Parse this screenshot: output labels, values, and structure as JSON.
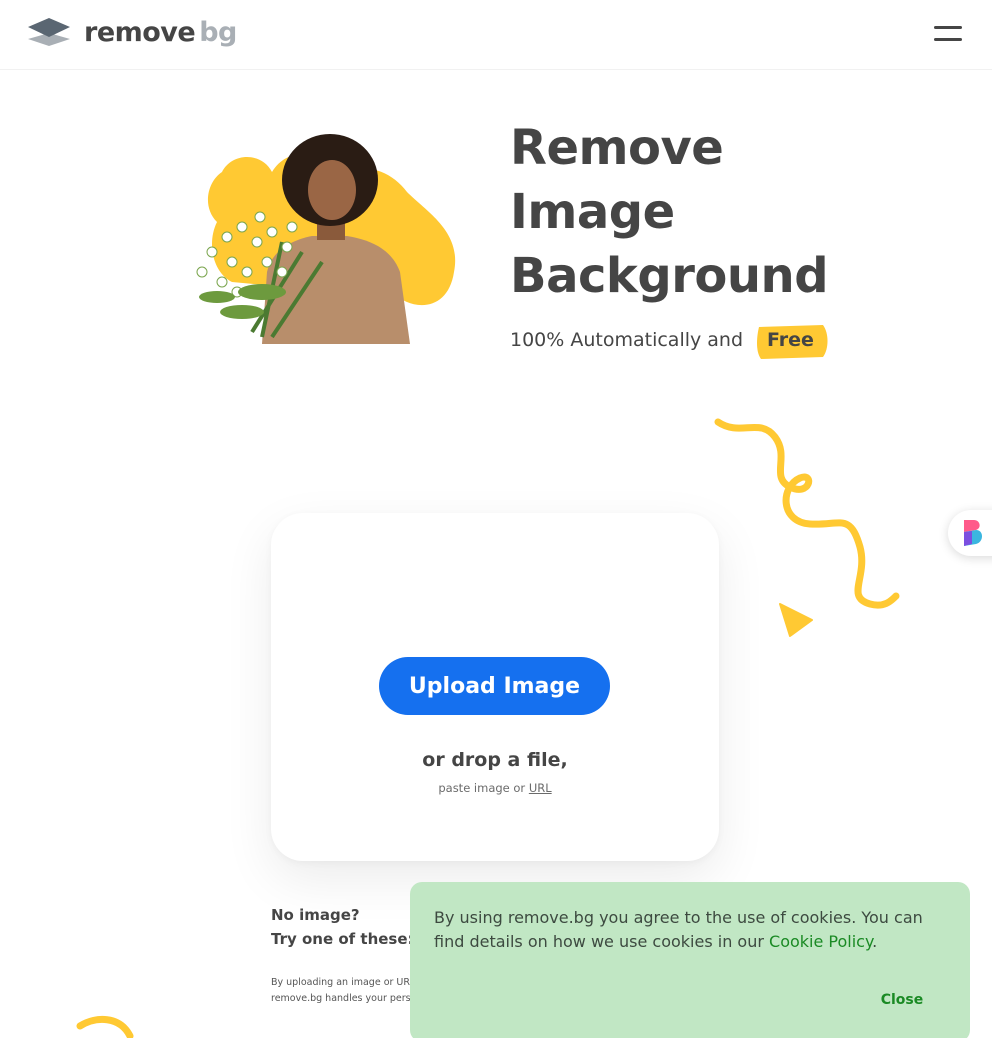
{
  "header": {
    "logo_text_main": "remove",
    "logo_text_accent": "bg",
    "menu_icon": "hamburger-icon"
  },
  "hero": {
    "title_line1": "Remove",
    "title_line2": "Image",
    "title_line3": "Background",
    "subtitle": "100% Automatically and",
    "subtitle_highlight": "Free",
    "accent_color": "#ffc933"
  },
  "upload": {
    "button_label": "Upload Image",
    "drop_text": "or drop a file,",
    "paste_text": "paste image or",
    "url_link": "URL",
    "button_color": "#1570ef"
  },
  "samples": {
    "line1": "No image?",
    "line2": "Try one of these:"
  },
  "terms": {
    "line1": "By uploading an image or URL",
    "line2": "remove.bg handles your pers"
  },
  "cookie": {
    "text": "By using remove.bg you agree to the use of cookies. You can find details on how we use cookies in our",
    "link": "Cookie Policy",
    "period": ".",
    "close_label": "Close",
    "background": "#c1e7c4"
  },
  "side_widget": {
    "icon": "app-widget-icon"
  }
}
